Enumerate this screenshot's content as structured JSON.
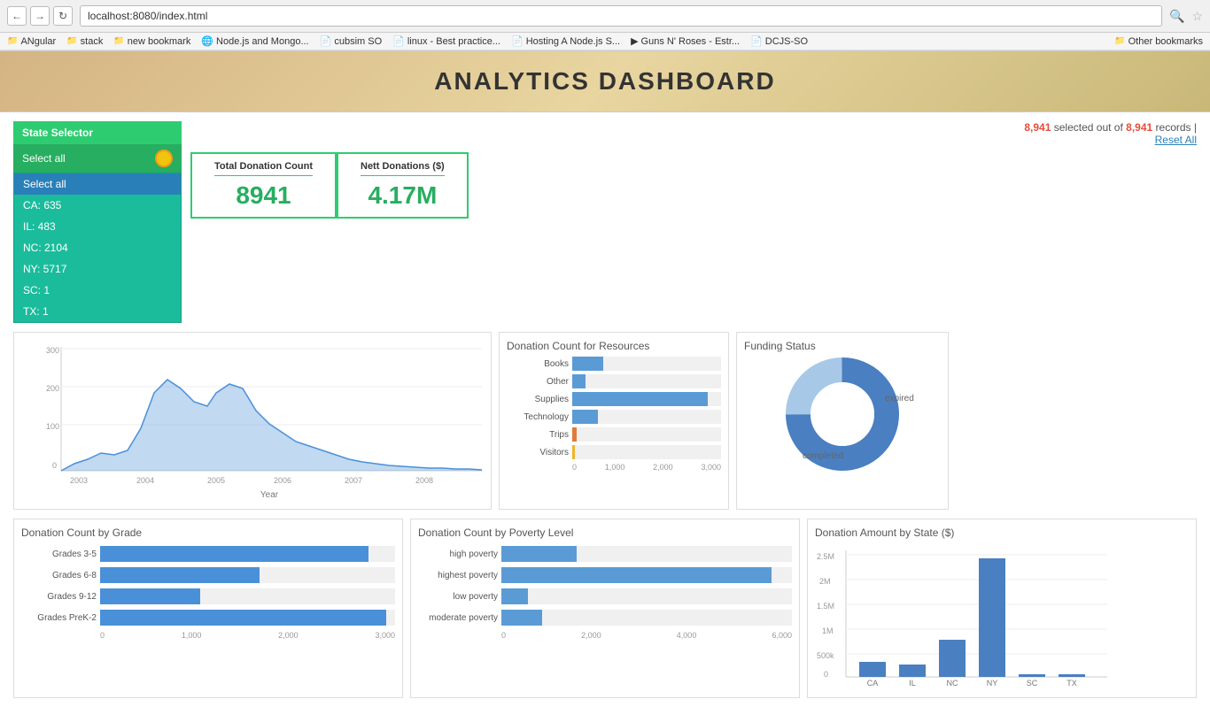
{
  "browser": {
    "url": "localhost:8080/index.html",
    "bookmarks": [
      {
        "label": "ANgular",
        "icon": "📁"
      },
      {
        "label": "stack",
        "icon": "📁"
      },
      {
        "label": "new bookmark",
        "icon": "📁"
      },
      {
        "label": "Node.js and Mongo...",
        "icon": "🌐"
      },
      {
        "label": "cubsim SO",
        "icon": "📄"
      },
      {
        "label": "linux - Best practice...",
        "icon": "📄"
      },
      {
        "label": "Hosting A Node.js S...",
        "icon": "📄"
      },
      {
        "label": "Guns N' Roses - Estr...",
        "icon": "▶"
      },
      {
        "label": "DCJS-SO",
        "icon": "📄"
      },
      {
        "label": "Other bookmarks",
        "icon": "📁"
      }
    ]
  },
  "page": {
    "title": "ANALYTICS DASHBOARD"
  },
  "state_selector": {
    "header": "State Selector",
    "placeholder": "Select all",
    "options": [
      {
        "label": "Select all",
        "selected": true
      },
      {
        "label": "CA: 635"
      },
      {
        "label": "IL: 483"
      },
      {
        "label": "NC: 2104"
      },
      {
        "label": "NY: 5717"
      },
      {
        "label": "SC: 1"
      },
      {
        "label": "TX: 1"
      }
    ]
  },
  "kpis": {
    "total_donation": {
      "label": "Total Donation Count",
      "value": "8941"
    },
    "nett_donations": {
      "label": "Nett Donations ($)",
      "value": "4.17M"
    }
  },
  "records_info": {
    "selected": "8,941",
    "total": "8,941",
    "text1": "selected out of",
    "text2": "records |",
    "reset_label": "Reset All"
  },
  "timeline_chart": {
    "title": "",
    "x_label": "Year",
    "x_ticks": [
      "2003",
      "2004",
      "2005",
      "2006",
      "2007",
      "2008"
    ],
    "y_ticks": [
      "0",
      "100",
      "200",
      "300"
    ]
  },
  "resources_chart": {
    "title": "Donation Count for Resources",
    "bars": [
      {
        "label": "Books",
        "value": 750,
        "max": 3500,
        "color": "blue"
      },
      {
        "label": "Other",
        "value": 300,
        "max": 3500,
        "color": "blue"
      },
      {
        "label": "Supplies",
        "value": 3200,
        "max": 3500,
        "color": "blue"
      },
      {
        "label": "Technology",
        "value": 600,
        "max": 3500,
        "color": "blue"
      },
      {
        "label": "Trips",
        "value": 120,
        "max": 3500,
        "color": "orange"
      },
      {
        "label": "Visitors",
        "value": 80,
        "max": 3500,
        "color": "yellow"
      }
    ],
    "x_ticks": [
      "0",
      "1,000",
      "2,000",
      "3,000"
    ]
  },
  "funding_chart": {
    "title": "Funding Status",
    "segments": [
      {
        "label": "completed",
        "value": 75,
        "color": "#4a7fc1"
      },
      {
        "label": "expired",
        "value": 25,
        "color": "#a8c8e8"
      }
    ]
  },
  "grade_chart": {
    "title": "Donation Count by Grade",
    "bars": [
      {
        "label": "Grades 3-5",
        "value": 3200,
        "max": 3500
      },
      {
        "label": "Grades 6-8",
        "value": 1900,
        "max": 3500
      },
      {
        "label": "Grades 9-12",
        "value": 1200,
        "max": 3500
      },
      {
        "label": "Grades PreK-2",
        "value": 3400,
        "max": 3500
      }
    ],
    "x_ticks": [
      "0",
      "1,000",
      "2,000",
      "3,000"
    ]
  },
  "poverty_chart": {
    "title": "Donation Count by Poverty Level",
    "bars": [
      {
        "label": "high poverty",
        "value": 1800,
        "max": 7000
      },
      {
        "label": "highest poverty",
        "value": 6500,
        "max": 7000
      },
      {
        "label": "low poverty",
        "value": 600,
        "max": 7000
      },
      {
        "label": "moderate poverty",
        "value": 1000,
        "max": 7000
      }
    ],
    "x_ticks": [
      "0",
      "2,000",
      "4,000",
      "6,000"
    ]
  },
  "state_amount_chart": {
    "title": "Donation Amount by State ($)",
    "bars": [
      {
        "label": "CA",
        "value": 200,
        "max": 2700,
        "height_pct": 12
      },
      {
        "label": "IL",
        "value": 180,
        "max": 2700,
        "height_pct": 10
      },
      {
        "label": "NC",
        "value": 700,
        "max": 2700,
        "height_pct": 30
      },
      {
        "label": "NY",
        "value": 2600,
        "max": 2700,
        "height_pct": 96
      },
      {
        "label": "SC",
        "value": 10,
        "max": 2700,
        "height_pct": 2
      },
      {
        "label": "TX",
        "value": 10,
        "max": 2700,
        "height_pct": 2
      }
    ],
    "y_ticks": [
      "0",
      "500k",
      "1M",
      "1.5M",
      "2M",
      "2.5M"
    ]
  }
}
